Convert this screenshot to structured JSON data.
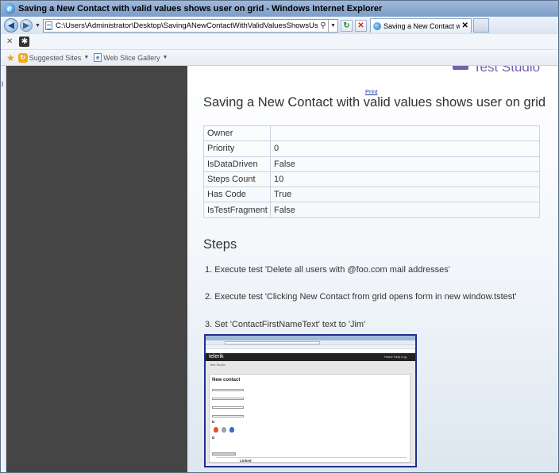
{
  "window": {
    "title": "Saving a New Contact with valid values shows user on grid - Windows Internet Explorer"
  },
  "nav": {
    "address": "C:\\Users\\Administrator\\Desktop\\SavingANewContactWithValidValuesShowsUserOnGrid.html",
    "tab_title": "Saving a New Contact with v..."
  },
  "favorites": {
    "items": [
      "Suggested Sites",
      "Web Slice Gallery"
    ]
  },
  "page": {
    "logo_text": "Test Studio",
    "print_label": "Print",
    "title": "Saving a New Contact with valid values shows user on grid",
    "properties": [
      {
        "key": "Owner",
        "value": ""
      },
      {
        "key": "Priority",
        "value": "0"
      },
      {
        "key": "IsDataDriven",
        "value": "False"
      },
      {
        "key": "Steps Count",
        "value": "10"
      },
      {
        "key": "Has Code",
        "value": "True"
      },
      {
        "key": "IsTestFragment",
        "value": "False"
      }
    ],
    "steps_heading": "Steps",
    "steps": [
      "1. Execute test 'Delete all users with @foo.com mail addresses'",
      "2. Execute test 'Clicking New Contact from grid opens form in new window.tstest'",
      "3. Set 'ContactFirstNameText' text to 'Jim'"
    ]
  },
  "thumbnail": {
    "logo": "telerik",
    "links": "Home  Help  Log",
    "subtitle": "Test Studio",
    "heading": "New contact",
    "linkedin": "Linked"
  }
}
